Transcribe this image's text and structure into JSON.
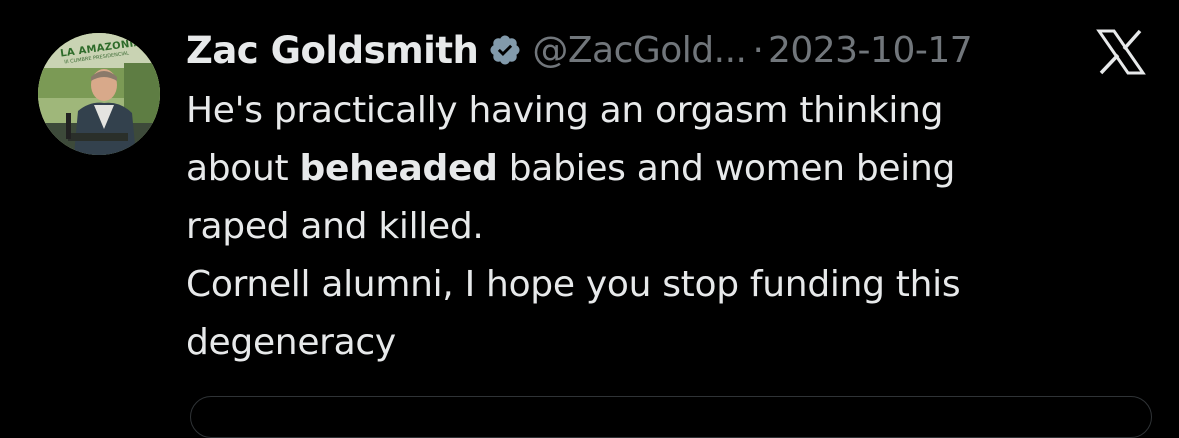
{
  "author": {
    "name": "Zac Goldsmith",
    "handle": "@ZacGold...",
    "separator": "·",
    "date": "2023-10-17",
    "verified": true,
    "avatar_logo_text": "LA AMAZONÍA",
    "avatar_logo_subtext": "III CUMBRE PRESIDENCIAL"
  },
  "tweet": {
    "line1": "He's practically having an orgasm thinking",
    "line2_prefix": "about ",
    "line2_bold": "beheaded",
    "line2_suffix": " babies and women being",
    "line3": "raped and killed.",
    "line4": "Cornell alumni, I hope you stop funding this",
    "line5": "degeneracy"
  },
  "icons": {
    "verified": "verified-badge-icon",
    "platform": "x-logo-icon"
  },
  "colors": {
    "background": "#000000",
    "text_primary": "#e7e9ea",
    "text_secondary": "#71767b",
    "verified_badge": "#829aab",
    "border": "#2f3336"
  }
}
